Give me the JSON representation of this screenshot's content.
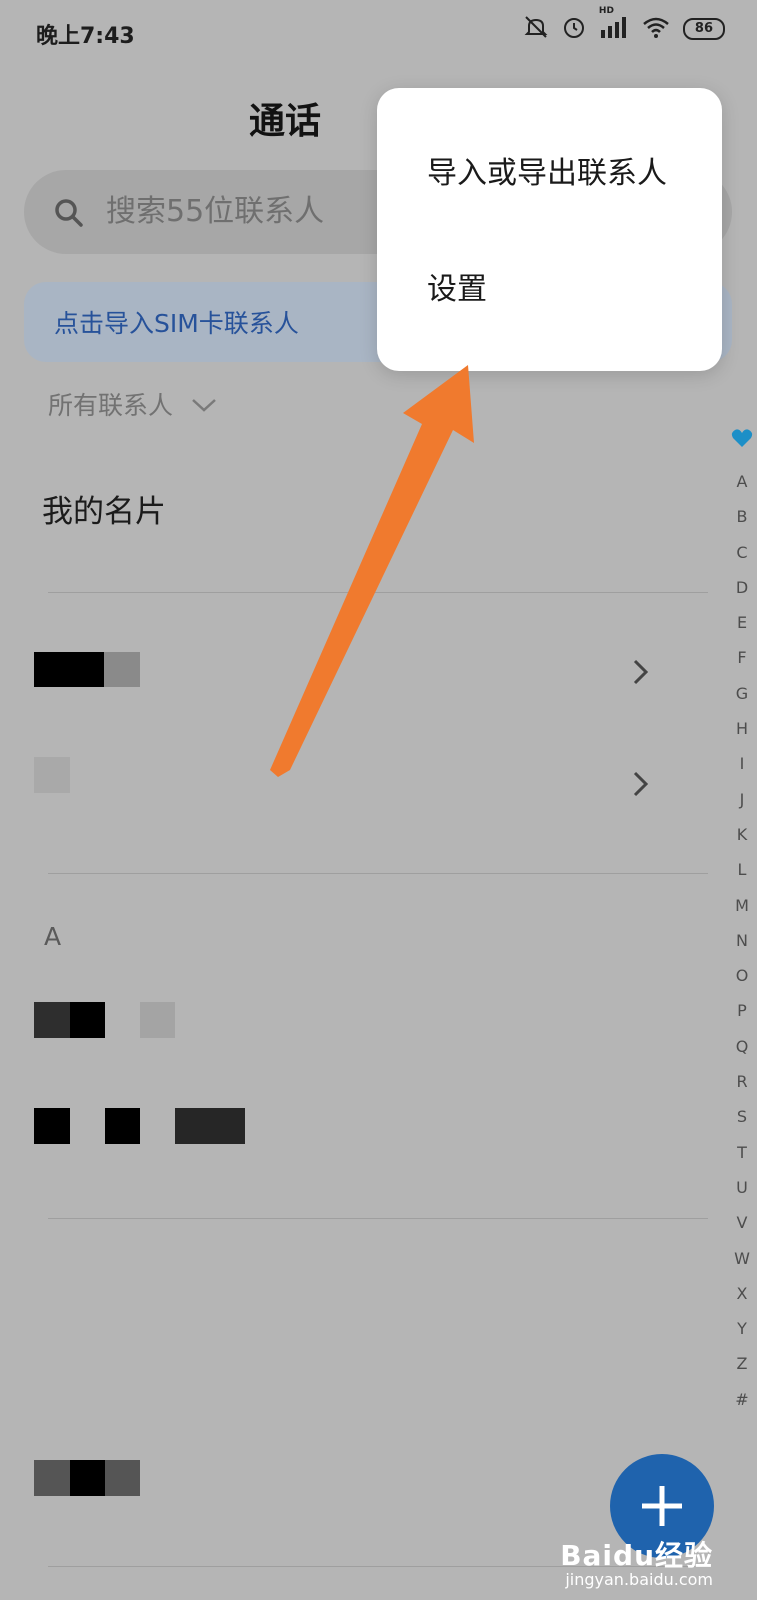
{
  "status_bar": {
    "time": "晚上7:43",
    "signal_badge": "HD",
    "battery": "86"
  },
  "header": {
    "title": "通话"
  },
  "search": {
    "placeholder": "搜索55位联系人"
  },
  "banner": {
    "text": "点击导入SIM卡联系人"
  },
  "filter": {
    "label": "所有联系人"
  },
  "my_card": {
    "label": "我的名片"
  },
  "sections": [
    {
      "header": "A"
    }
  ],
  "index_rail": {
    "letters": [
      "A",
      "B",
      "C",
      "D",
      "E",
      "F",
      "G",
      "H",
      "I",
      "J",
      "K",
      "L",
      "M",
      "N",
      "O",
      "P",
      "Q",
      "R",
      "S",
      "T",
      "U",
      "V",
      "W",
      "X",
      "Y",
      "Z",
      "#"
    ]
  },
  "popup_menu": {
    "items": [
      "导入或导出联系人",
      "设置"
    ]
  },
  "watermark": {
    "brand": "Baidu经验",
    "url": "jingyan.baidu.com"
  },
  "colors": {
    "overlay_bg": "#b5b5b5",
    "accent": "#1f63ad",
    "arrow": "#f07a2e",
    "banner_text": "#27529a"
  }
}
